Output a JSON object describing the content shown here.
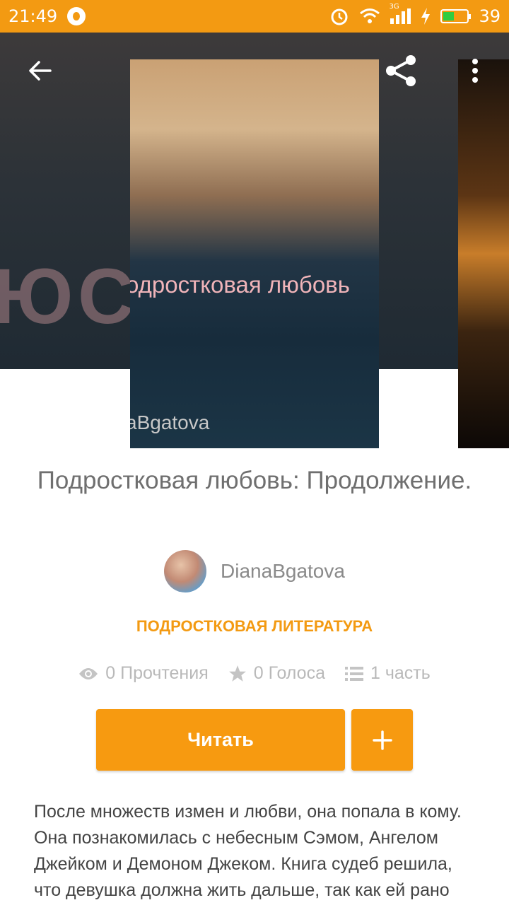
{
  "status_bar": {
    "time": "21:49",
    "battery_level": "39",
    "network_label": "3G",
    "icons": [
      "whatsapp-icon",
      "alarm-icon",
      "wifi-icon",
      "signal-icon",
      "charging-icon",
      "battery-icon"
    ]
  },
  "header": {
    "icons": [
      "back-arrow-icon",
      "share-icon",
      "more-vert-icon"
    ]
  },
  "cover": {
    "title_text": "одростковая любовь",
    "author_text": "aBgatova"
  },
  "story": {
    "title": "Подростковая любовь: Продолжение.",
    "author": "DianaBgatova",
    "genre": "ПОДРОСТКОВАЯ ЛИТЕРАТУРА",
    "stats": {
      "reads": "0 Прочтения",
      "votes": "0 Голоса",
      "parts": "1 часть"
    },
    "read_label": "Читать",
    "add_label": "+",
    "description": "После множеств измен и любви, она попала в кому. Она познакомилась с небесным Сэмом, Ангелом Джейком и Демоном Джеком. Книга судеб решила, что девушка должна жить дальше, так как ей рано"
  },
  "colors": {
    "accent": "#f39a12",
    "button": "#f79a10",
    "title_text": "#6f6f6f",
    "muted_text": "#b9b9b9"
  }
}
